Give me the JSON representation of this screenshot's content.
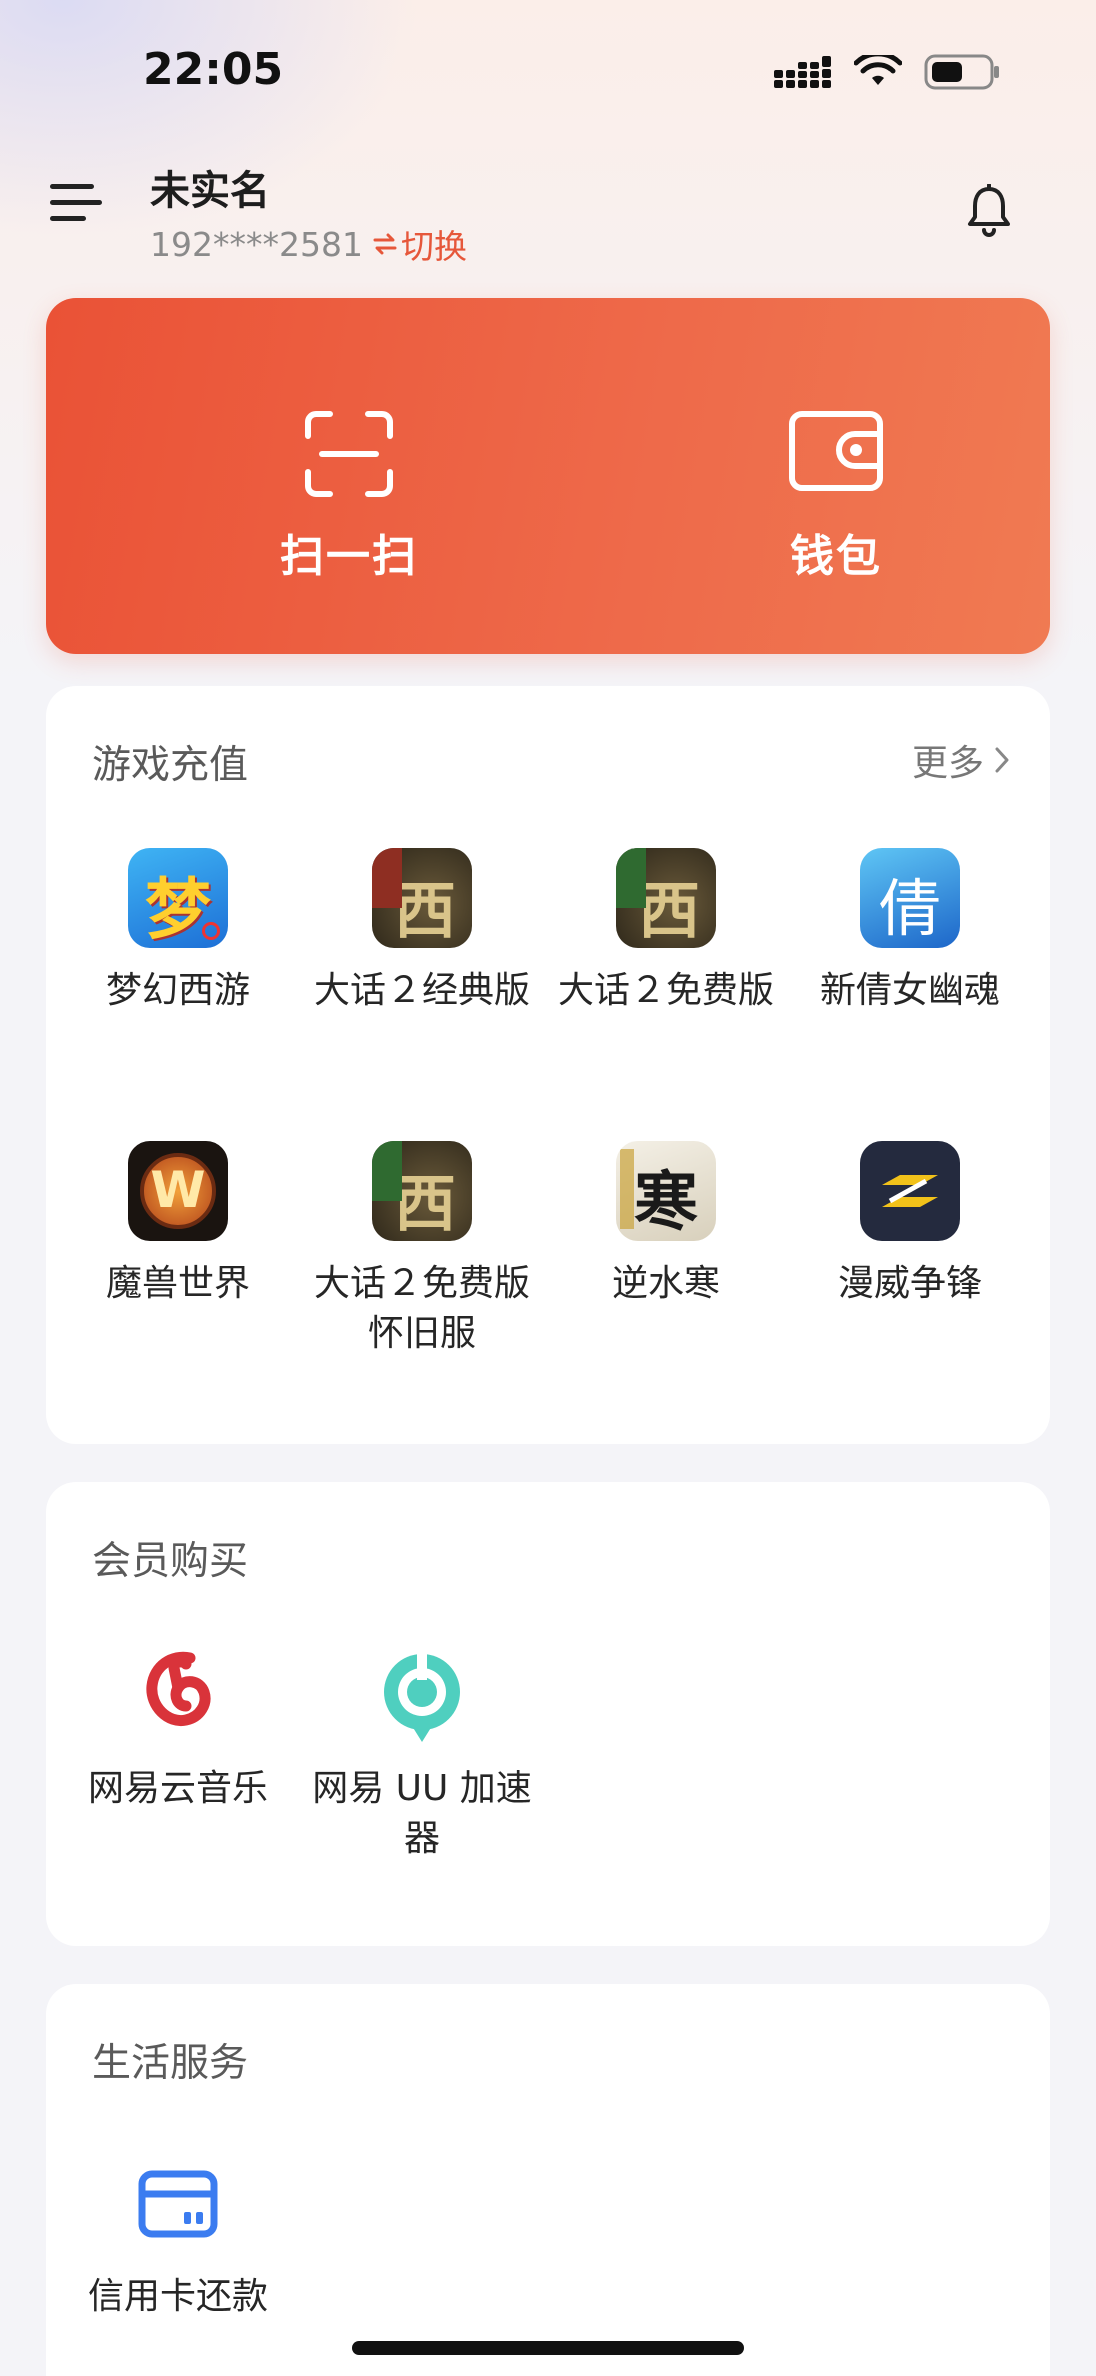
{
  "status": {
    "time": "22:05"
  },
  "header": {
    "name": "未实名",
    "phone": "192****2581",
    "switch_label": "切换"
  },
  "hero": {
    "scan_label": "扫一扫",
    "wallet_label": "钱包"
  },
  "games": {
    "title": "游戏充值",
    "more": "更多",
    "items": [
      {
        "label": "梦幻西游",
        "icon": "menghuan-icon",
        "glyph": "梦"
      },
      {
        "label": "大话２经典版",
        "icon": "dahua-classic-icon",
        "glyph": "西"
      },
      {
        "label": "大话２免费版",
        "icon": "dahua-free-icon",
        "glyph": "西"
      },
      {
        "label": "新倩女幽魂",
        "icon": "qiannv-icon",
        "glyph": "倩"
      },
      {
        "label": "魔兽世界",
        "icon": "wow-icon",
        "glyph": "W"
      },
      {
        "label": "大话２免费版怀旧服",
        "icon": "dahua-free-nostalgic-icon",
        "glyph": "西"
      },
      {
        "label": "逆水寒",
        "icon": "nishuihan-icon",
        "glyph": "寒"
      },
      {
        "label": "漫威争锋",
        "icon": "marvel-rivals-icon",
        "glyph": ""
      }
    ]
  },
  "membership": {
    "title": "会员购买",
    "items": [
      {
        "label": "网易云音乐",
        "icon": "netease-music-icon"
      },
      {
        "label": "网易 UU 加速器",
        "icon": "uu-accelerator-icon"
      }
    ]
  },
  "life": {
    "title": "生活服务",
    "items": [
      {
        "label": "信用卡还款",
        "icon": "credit-card-icon"
      }
    ]
  },
  "colors": {
    "accent": "#e6573a",
    "hero_start": "#ea5236",
    "hero_end": "#f07a52",
    "music_red": "#d9333a",
    "uu_teal": "#4fcfbf",
    "card_blue": "#3b7cf0"
  }
}
